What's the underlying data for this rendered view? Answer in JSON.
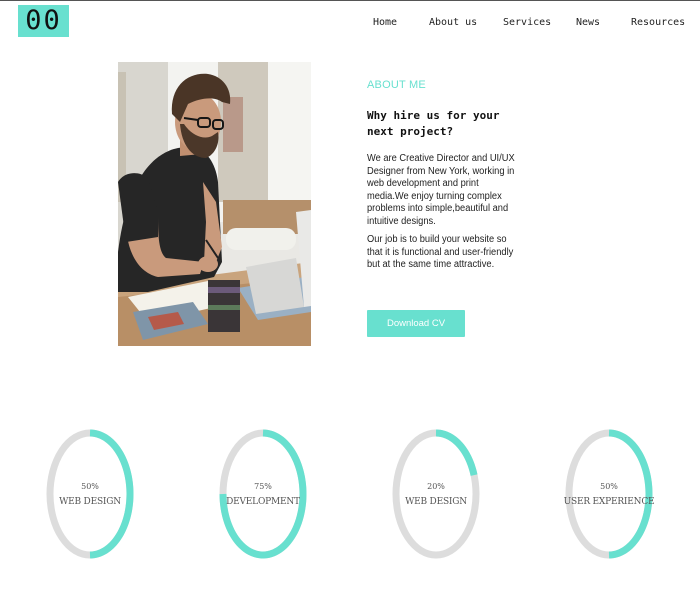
{
  "logo": {
    "text": "00"
  },
  "nav": {
    "items": [
      "Home",
      "About us",
      "Services",
      "News",
      "Resources"
    ]
  },
  "about": {
    "label": "ABOUT ME",
    "heading_line1": "Why hire us for your",
    "heading_line2": "next project?",
    "paragraph1": "We are Creative Director and UI/UX Designer from New York, working in web development and print media.We enjoy turning complex problems into simple,beautiful and intuitive designs.",
    "paragraph2": "Our job is to build your website so that it is functional and user-friendly but at the same time attractive.",
    "button_label": "Download CV"
  },
  "skills": [
    {
      "percent_label": "50%",
      "name": "WEB DESIGN",
      "fill": 0.5
    },
    {
      "percent_label": "75%",
      "name": "DEVELOPMENT",
      "fill": 0.75
    },
    {
      "percent_label": "20%",
      "name": "WEB DESIGN",
      "fill": 0.2
    },
    {
      "percent_label": "50%",
      "name": "USER EXPERIENCE",
      "fill": 0.5
    }
  ],
  "colors": {
    "accent": "#68e0cf",
    "ring_track": "#dddddd"
  }
}
